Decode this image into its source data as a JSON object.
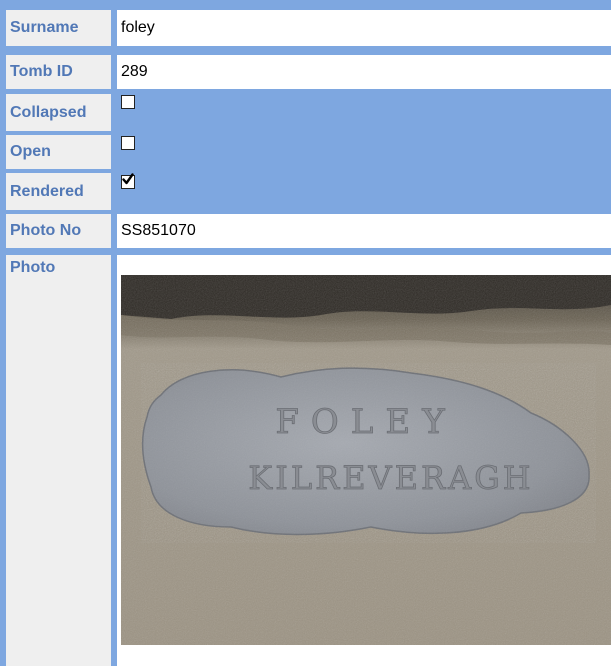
{
  "fields": {
    "surname": {
      "label": "Surname",
      "value": "foley"
    },
    "tomb_id": {
      "label": "Tomb ID",
      "value": "289"
    },
    "collapsed": {
      "label": "Collapsed",
      "checked": false
    },
    "open": {
      "label": "Open",
      "checked": false
    },
    "rendered": {
      "label": "Rendered",
      "checked": true
    },
    "photo_no": {
      "label": "Photo No",
      "value": "SS851070"
    },
    "photo": {
      "label": "Photo",
      "plaque_text_line1": "FOLEY",
      "plaque_text_line2": "KILREVERAGH"
    }
  },
  "colors": {
    "form_background": "#7ea7e0",
    "label_background": "#efefef",
    "label_text": "#5178b6",
    "value_background": "#ffffff"
  }
}
